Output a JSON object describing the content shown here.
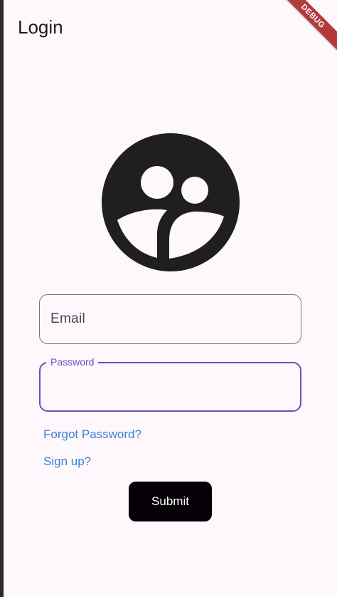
{
  "appbar": {
    "title": "Login",
    "debug_banner": "DEBUG"
  },
  "icons": {
    "avatar": "account-circle-icon"
  },
  "form": {
    "email_placeholder": "Email",
    "password_label": "Password"
  },
  "links": {
    "forgot_password": "Forgot Password?",
    "sign_up": "Sign up?"
  },
  "actions": {
    "submit_label": "Submit"
  },
  "colors": {
    "background": "#fef7fc",
    "focus_border": "#6f4bb8",
    "link": "#3b82d6",
    "button": "#040005",
    "debug_banner": "#b13b3b"
  }
}
